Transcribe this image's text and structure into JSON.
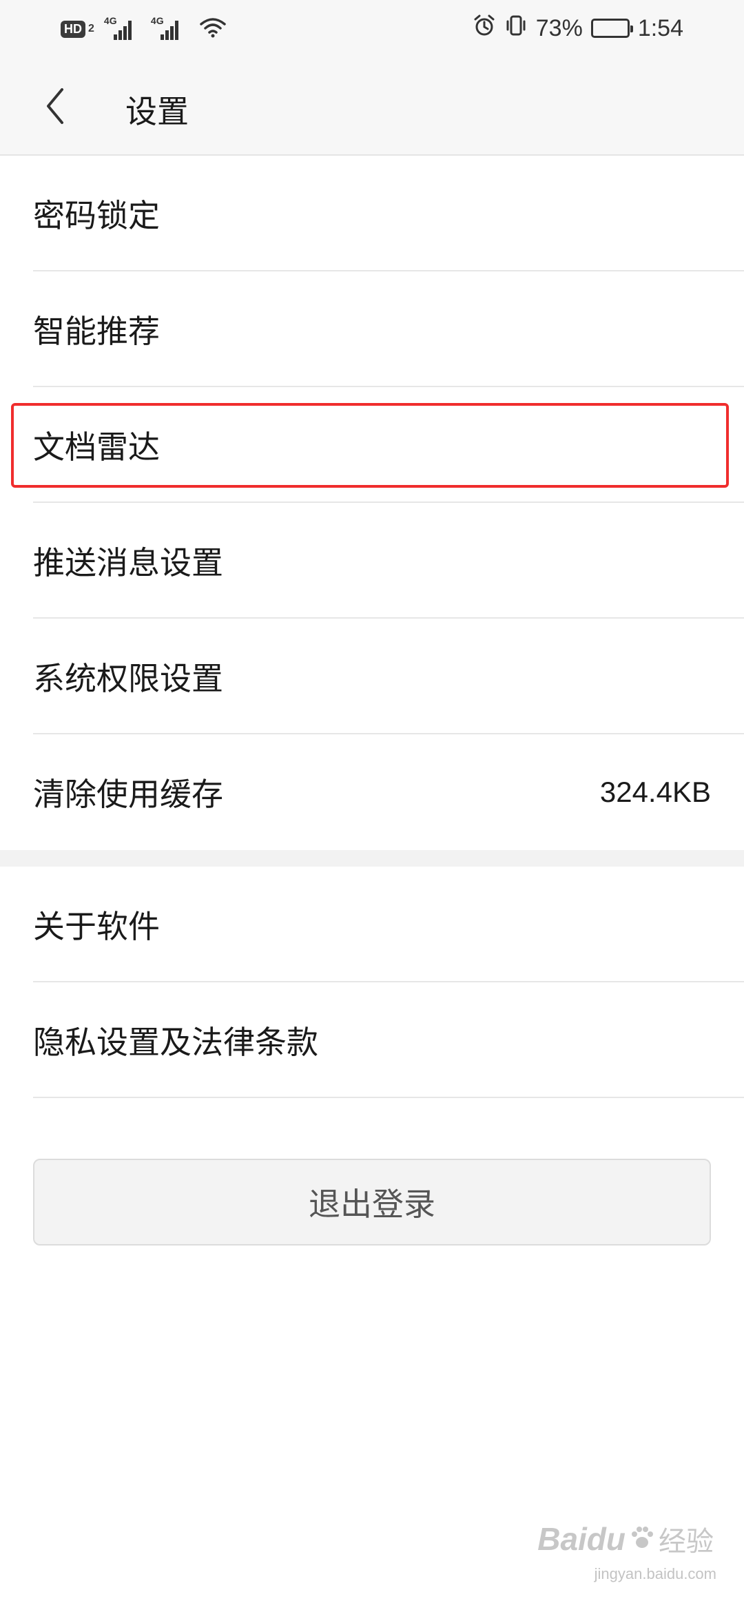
{
  "status_bar": {
    "hd_label": "HD",
    "hd_sub": "2",
    "network_1": "4G",
    "network_2": "4G",
    "battery_percent": "73%",
    "battery_level": 0.73,
    "time": "1:54"
  },
  "nav": {
    "title": "设置"
  },
  "settings": {
    "group_1": [
      {
        "label": "密码锁定"
      },
      {
        "label": "智能推荐"
      },
      {
        "label": "文档雷达"
      },
      {
        "label": "推送消息设置"
      },
      {
        "label": "系统权限设置"
      },
      {
        "label": "清除使用缓存",
        "value": "324.4KB"
      }
    ],
    "group_2": [
      {
        "label": "关于软件"
      },
      {
        "label": "隐私设置及法律条款"
      }
    ]
  },
  "logout_label": "退出登录",
  "watermark": {
    "brand": "Baidu",
    "suffix": "经验",
    "url": "jingyan.baidu.com"
  },
  "colors": {
    "highlight": "#f02d2d",
    "nav_background": "#f7f7f7"
  }
}
